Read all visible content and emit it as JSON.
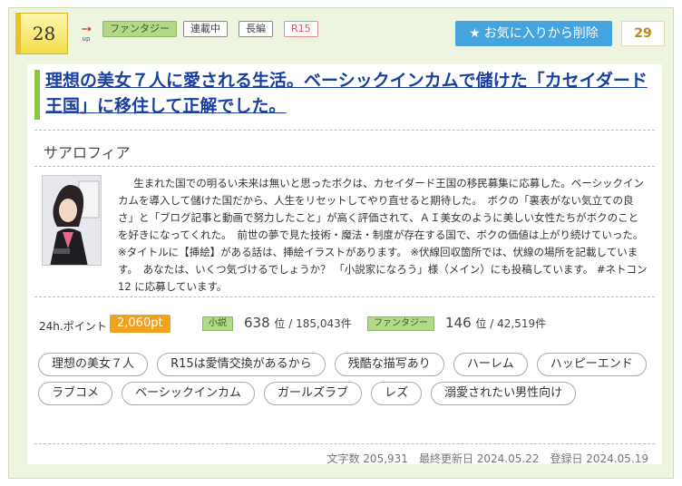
{
  "rank": "28",
  "up_label": "up",
  "tags": {
    "genre": "ファンタジー",
    "serial": "連載中",
    "length": "長編",
    "rating": "R15"
  },
  "favorite": {
    "button_label": "お気に入りから削除",
    "count": "29"
  },
  "title": "理想の美女７人に愛される生活。ベーシックインカムで儲けた「カセイダード王国」に移住して正解でした。",
  "author": "サアロフィア",
  "synopsis": "生まれた国での明るい未来は無いと思ったボクは、カセイダード王国の移民募集に応募した。ベーシックインカムを導入して儲けた国だから、人生をリセットしてやり直せると期待した。　ボクの「裏表がない気立ての良さ」と「ブログ記事と動画で努力したこと」が高く評価されて、ＡＩ美女のように美しい女性たちがボクのことを好きになってくれた。　前世の夢で見た技術・魔法・制度が存在する国で、ボクの価値は上がり続けていった。 ※タイトルに【挿絵】がある話は、挿絵イラストがあります。 ※伏線回収箇所では、伏線の場所を記載しています。　あなたは、いくつ気づけるでしょうか？ 「小説家になろう」様（メイン）にも投稿しています。 #ネトコン12 に応募しています。",
  "stats": {
    "points_label": "24h.ポイント",
    "points_value": "2,060pt",
    "novel_tag": "小説",
    "novel_rank": "638",
    "novel_total": "位 / 185,043件",
    "genre_tag": "ファンタジー",
    "genre_rank": "146",
    "genre_total": "位 / 42,519件"
  },
  "keywords": [
    "理想の美女７人",
    "R15は愛情交換があるから",
    "残酷な描写あり",
    "ハーレム",
    "ハッピーエンド",
    "ラブコメ",
    "ベーシックインカム",
    "ガールズラブ",
    "レズ",
    "溺愛されたい男性向け"
  ],
  "meta": {
    "chars": "文字数 205,931",
    "updated": "最終更新日 2024.05.22",
    "registered": "登録日 2024.05.19"
  },
  "colors": {
    "card_bg": "#edf5e0",
    "title": "#1a3f9e",
    "accent_green": "#8cc63e",
    "fav_button": "#45a3de",
    "points": "#f0a21e"
  },
  "icons": {
    "favorite": "star-icon",
    "rank_up": "up-arrow-icon"
  }
}
